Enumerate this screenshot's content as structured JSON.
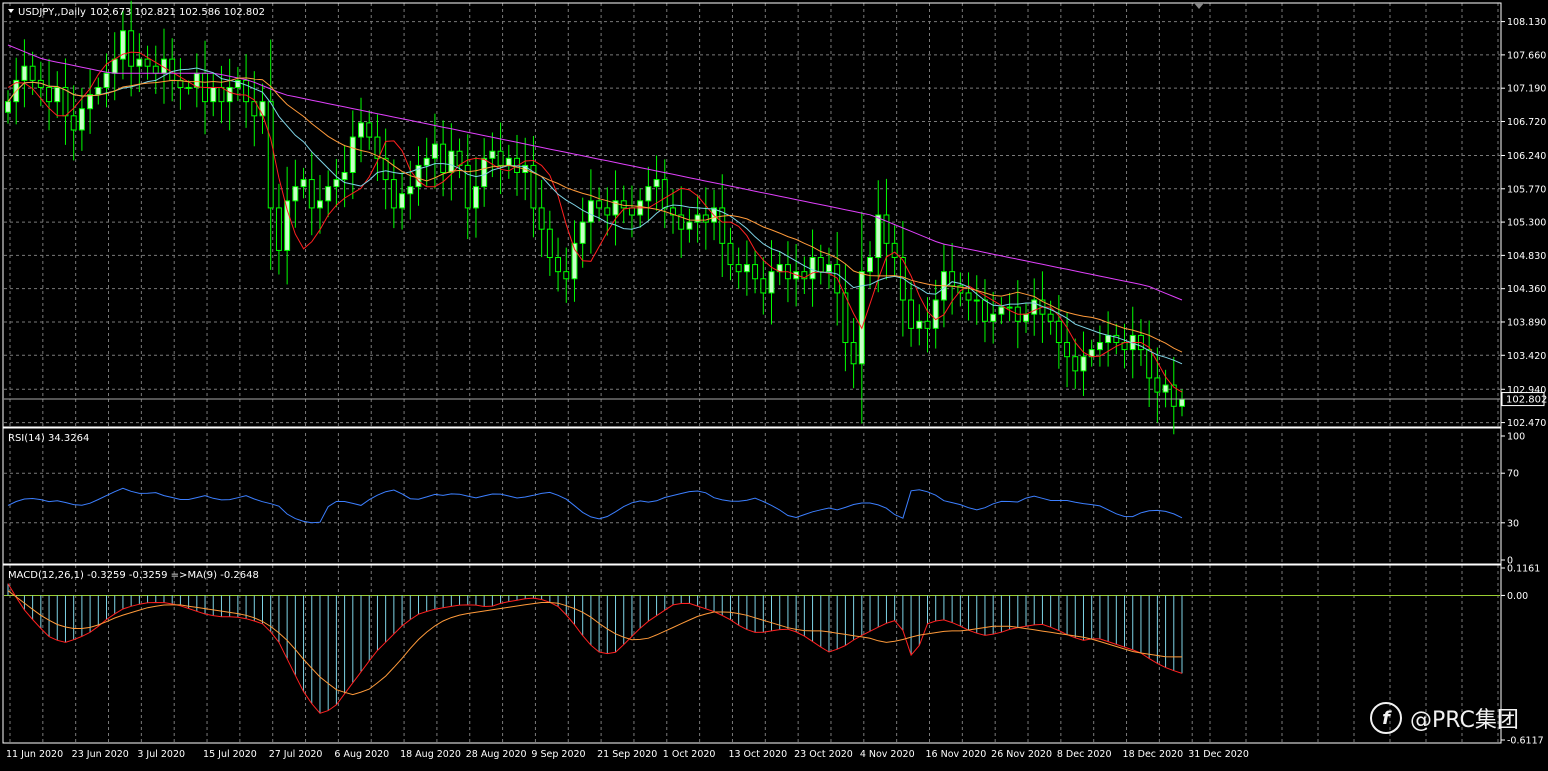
{
  "colors": {
    "background": "#000000",
    "grid": "#7a7a7a",
    "text": "#ffffff",
    "bull_candle": "#c8ffc8",
    "candle_outline": "#00ff00",
    "bear_candle": "#000000",
    "ma_fast": "#ff2020",
    "ma_medium": "#7fd4e6",
    "ma_slow": "#ff9a3a",
    "ma_long": "#e040fb",
    "rsi_line": "#3c7fff",
    "macd_hist": "#7fd4e6",
    "macd_line": "#ff2020",
    "macd_signal": "#ff9a3a",
    "zero_line": "#9acd32"
  },
  "watermark": {
    "icon": "prc-logo-icon",
    "text": "@PRC集团"
  },
  "chart_data": [
    {
      "type": "candlestick",
      "title": "USDJPY,,Daily",
      "ohlc_label": "102.673 102.821 102.586 102.802",
      "current_price_label": "102.802",
      "current_price": 102.802,
      "ylim": [
        102.45,
        108.35
      ],
      "yticks": [
        108.13,
        107.66,
        107.19,
        106.72,
        106.24,
        105.77,
        105.3,
        104.83,
        104.36,
        103.89,
        103.42,
        102.94,
        102.47
      ],
      "ytick_labels": [
        "108.130",
        "107.660",
        "107.190",
        "106.720",
        "106.240",
        "105.770",
        "105.300",
        "104.830",
        "104.360",
        "103.890",
        "103.420",
        "102.940",
        "102.470"
      ],
      "xtick_labels": [
        "11 Jun 2020",
        "23 Jun 2020",
        "3 Jul 2020",
        "15 Jul 2020",
        "27 Jul 2020",
        "6 Aug 2020",
        "18 Aug 2020",
        "28 Aug 2020",
        "9 Sep 2020",
        "21 Sep 2020",
        "1 Oct 2020",
        "13 Oct 2020",
        "23 Oct 2020",
        "4 Nov 2020",
        "16 Nov 2020",
        "26 Nov 2020",
        "8 Dec 2020",
        "18 Dec 2020",
        "31 Dec 2020"
      ],
      "xtick_index": [
        0,
        8,
        16,
        24,
        32,
        40,
        48,
        56,
        64,
        72,
        80,
        88,
        96,
        104,
        112,
        120,
        128,
        136,
        144
      ],
      "close": [
        107.0,
        107.3,
        107.5,
        107.3,
        107.2,
        107.0,
        107.2,
        106.8,
        106.6,
        106.9,
        107.1,
        107.2,
        107.4,
        107.6,
        108.0,
        107.5,
        107.6,
        107.5,
        107.4,
        107.6,
        107.3,
        107.2,
        107.2,
        107.4,
        107.0,
        107.2,
        107.0,
        107.2,
        107.3,
        107.0,
        106.8,
        107.0,
        105.5,
        104.9,
        105.6,
        105.8,
        105.9,
        105.5,
        105.6,
        105.8,
        105.9,
        106.0,
        106.5,
        106.7,
        106.5,
        106.2,
        105.9,
        105.5,
        105.7,
        105.8,
        106.1,
        106.2,
        106.4,
        106.0,
        106.3,
        106.1,
        105.5,
        105.8,
        106.2,
        106.3,
        106.1,
        106.2,
        106.0,
        106.1,
        105.5,
        105.2,
        104.8,
        104.6,
        104.5,
        105.0,
        105.3,
        105.6,
        105.5,
        105.4,
        105.6,
        105.5,
        105.4,
        105.6,
        105.8,
        105.9,
        105.5,
        105.4,
        105.2,
        105.3,
        105.4,
        105.3,
        105.5,
        105.0,
        104.7,
        104.6,
        104.7,
        104.5,
        104.3,
        104.6,
        104.7,
        104.5,
        104.6,
        104.5,
        104.8,
        104.6,
        104.7,
        104.3,
        103.6,
        103.3,
        104.6,
        104.8,
        105.4,
        105.0,
        104.8,
        104.2,
        103.8,
        103.9,
        103.8,
        104.2,
        104.6,
        104.4,
        104.3,
        104.2,
        104.2,
        103.9,
        104.0,
        104.1,
        104.1,
        103.9,
        104.0,
        104.2,
        104.0,
        103.9,
        103.6,
        103.4,
        103.2,
        103.4,
        103.5,
        103.6,
        103.7,
        103.6,
        103.5,
        103.7,
        103.5,
        103.1,
        102.9,
        103.0,
        102.7,
        102.8
      ],
      "series": [
        {
          "name": "",
          "line": "ma_fast",
          "values": [
            107.2,
            107.3,
            107.2,
            107.0,
            106.8,
            106.8,
            107.0,
            107.2,
            107.5,
            107.6,
            107.7,
            107.7,
            107.6,
            107.5,
            107.4,
            107.3,
            107.2,
            107.2,
            107.2,
            107.1,
            107.1,
            107.0,
            106.6,
            105.8,
            105.2,
            104.9,
            105.1,
            105.4,
            105.6,
            105.7,
            105.8,
            106.1,
            106.5,
            106.4,
            106.0,
            105.8,
            105.8,
            105.9,
            106.1,
            106.2,
            106.2,
            106.1,
            106.0,
            106.1,
            106.2,
            106.1,
            105.9,
            105.3,
            104.8,
            104.7,
            105.0,
            105.3,
            105.5,
            105.5,
            105.5,
            105.6,
            105.7,
            105.8,
            105.7,
            105.5,
            105.3,
            105.3,
            105.2,
            104.9,
            104.7,
            104.6,
            104.6,
            104.5,
            104.6,
            104.6,
            104.5,
            104.1,
            103.8,
            104.3,
            104.8,
            104.9,
            104.6,
            104.2,
            103.9,
            104.0,
            104.3,
            104.4,
            104.3,
            104.2,
            104.1,
            104.0,
            104.0,
            104.1,
            104.1,
            103.9,
            103.6,
            103.4,
            103.4,
            103.5,
            103.6,
            103.6,
            103.6,
            103.3,
            103.0,
            102.9
          ]
        },
        {
          "name": "",
          "line": "ma_long",
          "values": [
            107.8,
            107.6,
            107.5,
            107.4,
            107.4,
            107.4,
            107.4,
            107.3,
            107.1,
            107.0,
            106.9,
            106.8,
            106.7,
            106.6,
            106.5,
            106.4,
            106.3,
            106.2,
            106.1,
            106.0,
            105.9,
            105.8,
            105.7,
            105.6,
            105.5,
            105.4,
            105.2,
            105.0,
            104.9,
            104.8,
            104.7,
            104.6,
            104.5,
            104.4,
            104.2
          ]
        }
      ]
    },
    {
      "type": "line",
      "title": "RSI(14) 34.3264",
      "ylim": [
        0,
        100
      ],
      "yticks": [
        100,
        70,
        30,
        0
      ],
      "ytick_labels": [
        "100",
        "70",
        "30",
        "0"
      ],
      "series": [
        {
          "name": "",
          "line": "rsi_line",
          "values": [
            44,
            48,
            50,
            49,
            47,
            48,
            45,
            44,
            46,
            50,
            54,
            58,
            55,
            53,
            55,
            52,
            50,
            48,
            50,
            52,
            49,
            48,
            50,
            52,
            48,
            46,
            44,
            36,
            32,
            30,
            30,
            46,
            48,
            46,
            44,
            50,
            54,
            57,
            53,
            48,
            50,
            53,
            52,
            54,
            52,
            50,
            52,
            54,
            52,
            50,
            51,
            53,
            55,
            52,
            48,
            40,
            35,
            33,
            36,
            42,
            46,
            48,
            46,
            50,
            52,
            54,
            56,
            55,
            50,
            48,
            47,
            48,
            50,
            46,
            42,
            36,
            34,
            38,
            40,
            42,
            40,
            44,
            46,
            46,
            44,
            40,
            30,
            58,
            56,
            54,
            48,
            46,
            44,
            40,
            42,
            46,
            48,
            46,
            50,
            52,
            48,
            48,
            48,
            46,
            45,
            44,
            40,
            36,
            34,
            38,
            40,
            40,
            38,
            34
          ]
        }
      ]
    },
    {
      "type": "bar",
      "title": "MACD(12,26,1) -0.3259 -0.3259 =>MA(9) -0.2648",
      "ylim": [
        -0.6117,
        0.1161
      ],
      "yticks": [
        0.1161,
        0.0,
        -0.6117
      ],
      "ytick_labels": [
        "0.1161",
        "0.00",
        "-0.6117"
      ],
      "values": [
        0.05,
        -0.05,
        -0.12,
        -0.18,
        -0.2,
        -0.18,
        -0.15,
        -0.1,
        -0.06,
        -0.04,
        -0.03,
        -0.03,
        -0.04,
        -0.06,
        -0.08,
        -0.09,
        -0.09,
        -0.1,
        -0.12,
        -0.18,
        -0.3,
        -0.42,
        -0.5,
        -0.48,
        -0.4,
        -0.32,
        -0.24,
        -0.18,
        -0.12,
        -0.08,
        -0.06,
        -0.05,
        -0.04,
        -0.04,
        -0.05,
        -0.03,
        -0.02,
        -0.01,
        -0.02,
        -0.05,
        -0.12,
        -0.2,
        -0.25,
        -0.24,
        -0.18,
        -0.12,
        -0.08,
        -0.04,
        -0.03,
        -0.05,
        -0.07,
        -0.1,
        -0.14,
        -0.16,
        -0.15,
        -0.14,
        -0.16,
        -0.2,
        -0.24,
        -0.22,
        -0.18,
        -0.15,
        -0.12,
        -0.1,
        -0.28,
        -0.12,
        -0.1,
        -0.12,
        -0.15,
        -0.17,
        -0.16,
        -0.14,
        -0.13,
        -0.12,
        -0.14,
        -0.17,
        -0.19,
        -0.18,
        -0.2,
        -0.22,
        -0.24,
        -0.28,
        -0.31,
        -0.33
      ],
      "series": [
        {
          "name": "",
          "line": "macd_signal",
          "values": [
            0.02,
            -0.03,
            -0.08,
            -0.12,
            -0.14,
            -0.14,
            -0.12,
            -0.09,
            -0.07,
            -0.05,
            -0.04,
            -0.04,
            -0.05,
            -0.06,
            -0.07,
            -0.08,
            -0.1,
            -0.14,
            -0.2,
            -0.28,
            -0.35,
            -0.4,
            -0.42,
            -0.4,
            -0.35,
            -0.28,
            -0.2,
            -0.14,
            -0.1,
            -0.08,
            -0.07,
            -0.06,
            -0.05,
            -0.04,
            -0.03,
            -0.03,
            -0.05,
            -0.08,
            -0.13,
            -0.17,
            -0.19,
            -0.18,
            -0.15,
            -0.12,
            -0.09,
            -0.07,
            -0.07,
            -0.08,
            -0.1,
            -0.12,
            -0.14,
            -0.15,
            -0.15,
            -0.16,
            -0.17,
            -0.18,
            -0.2,
            -0.19,
            -0.17,
            -0.16,
            -0.15,
            -0.15,
            -0.14,
            -0.13,
            -0.13,
            -0.14,
            -0.15,
            -0.16,
            -0.17,
            -0.18,
            -0.2,
            -0.22,
            -0.24,
            -0.25,
            -0.26,
            -0.26
          ]
        }
      ]
    }
  ]
}
